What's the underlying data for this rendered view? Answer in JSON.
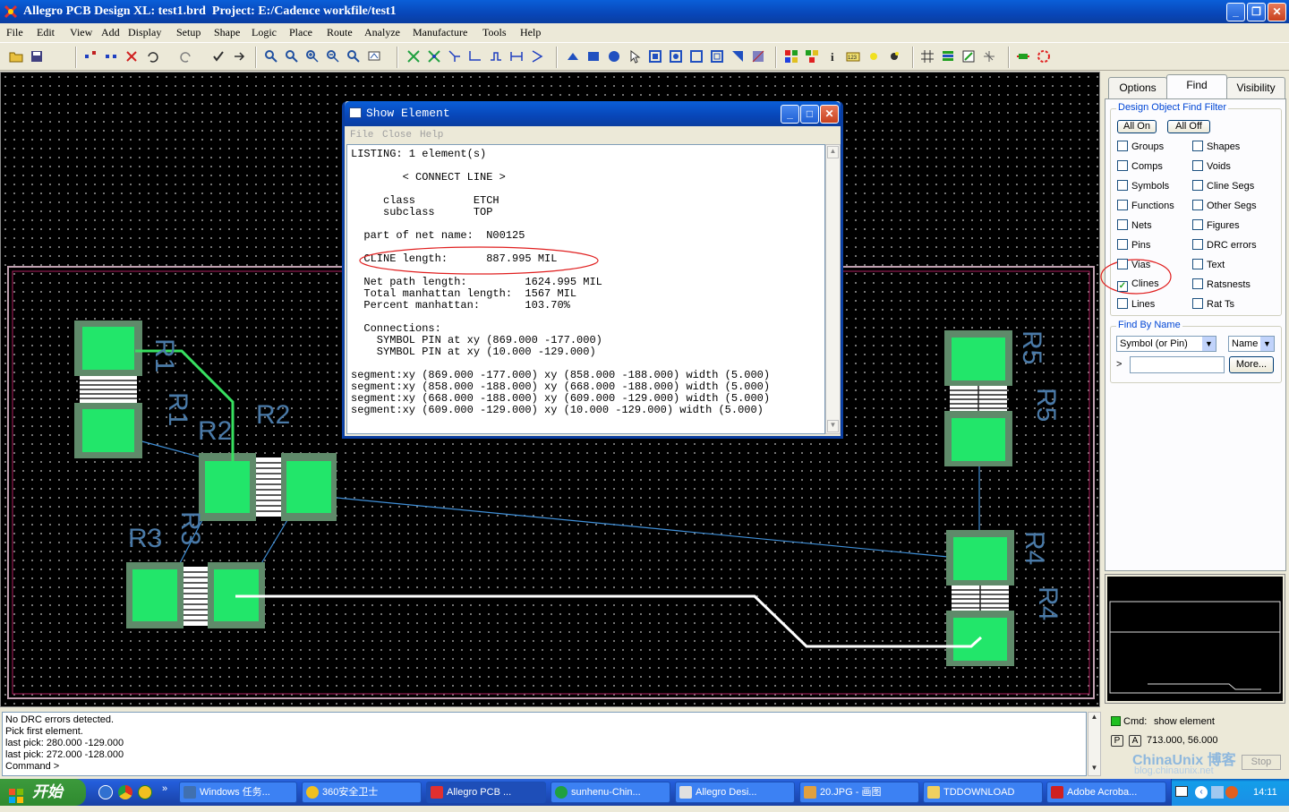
{
  "window": {
    "title": "Allegro PCB Design XL: test1.brd  Project: E:/Cadence workfile/test1"
  },
  "menubar": [
    "File",
    "Edit",
    "View",
    "Add",
    "Display",
    "Setup",
    "Shape",
    "Logic",
    "Place",
    "Route",
    "Analyze",
    "Manufacture",
    "Tools",
    "Help"
  ],
  "canvas": {
    "refdes": [
      "R1",
      "R1",
      "R2",
      "R2",
      "R3",
      "R3",
      "R5",
      "R5",
      "R4",
      "R4"
    ]
  },
  "dialog": {
    "title": "Show Element",
    "menu": [
      "File",
      "Close",
      "Help"
    ],
    "lines": [
      "LISTING: 1 element(s)",
      "        < CONNECT LINE >",
      "     class         ETCH",
      "     subclass      TOP",
      "  part of net name:  N00125",
      "  CLINE length:      887.995 MIL",
      "  Net path length:         1624.995 MIL",
      "  Total manhattan length:  1567 MIL",
      "  Percent manhattan:       103.70%",
      "  Connections:",
      "    SYMBOL PIN at xy (869.000 -177.000)",
      "    SYMBOL PIN at xy (10.000 -129.000)",
      "segment:xy (869.000 -177.000) xy (858.000 -188.000) width (5.000)",
      "segment:xy (858.000 -188.000) xy (668.000 -188.000) width (5.000)",
      "segment:xy (668.000 -188.000) xy (609.000 -129.000) width (5.000)",
      "segment:xy (609.000 -129.000) xy (10.000 -129.000) width (5.000)"
    ]
  },
  "rightpanel": {
    "tabs": [
      "Options",
      "Find",
      "Visibility"
    ],
    "filter_title": "Design Object Find Filter",
    "all_on": "All On",
    "all_off": "All Off",
    "left_items": [
      {
        "label": "Groups",
        "checked": false
      },
      {
        "label": "Comps",
        "checked": false
      },
      {
        "label": "Symbols",
        "checked": false
      },
      {
        "label": "Functions",
        "checked": false
      },
      {
        "label": "Nets",
        "checked": false
      },
      {
        "label": "Pins",
        "checked": false
      },
      {
        "label": "Vias",
        "checked": false
      },
      {
        "label": "Clines",
        "checked": true
      },
      {
        "label": "Lines",
        "checked": false
      }
    ],
    "right_items": [
      {
        "label": "Shapes",
        "checked": false
      },
      {
        "label": "Voids",
        "checked": false
      },
      {
        "label": "Cline Segs",
        "checked": false
      },
      {
        "label": "Other Segs",
        "checked": false
      },
      {
        "label": "Figures",
        "checked": false
      },
      {
        "label": "DRC errors",
        "checked": false
      },
      {
        "label": "Text",
        "checked": false
      },
      {
        "label": "Ratsnests",
        "checked": false
      },
      {
        "label": "Rat Ts",
        "checked": false
      }
    ],
    "find_by_name_title": "Find By Name",
    "find_type": "Symbol (or Pin)",
    "find_mode": "Name",
    "find_arrow": ">",
    "find_value": "",
    "more_button": "More..."
  },
  "log": {
    "lines": [
      "No DRC errors detected.",
      "Pick first element.",
      "last pick:  280.000 -129.000",
      "last pick:  272.000 -128.000",
      "Command >"
    ]
  },
  "status": {
    "cmd_label": "Cmd:",
    "cmd_value": "show element",
    "p_label": "P",
    "a_label": "A",
    "coords": "713.000, 56.000",
    "stop": "Stop",
    "watermark": "ChinaUnix 博客",
    "watermark_url": "blog.chinaunix.net"
  },
  "taskbar": {
    "start": "开始",
    "tasks": [
      "Windows 任务...",
      "360安全卫士",
      "Allegro PCB ...",
      "sunhenu-Chin...",
      "Allegro Desi...",
      "20.JPG - 画图",
      "TDDOWNLOAD",
      "Adobe Acroba..."
    ],
    "clock": "14:11"
  },
  "colors": {
    "pad": "#22e66a",
    "pad_border": "#5f8a6a",
    "trace_green": "#38e060",
    "trace_white": "#ffffff",
    "ratsnest": "#3f8fd8",
    "board_outline": "#c0a0b0",
    "refdes": "#4a7aa8",
    "highlight": "#e02020"
  }
}
